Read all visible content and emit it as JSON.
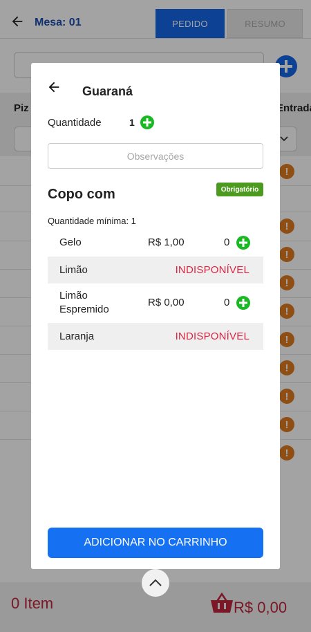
{
  "header": {
    "mesa": "Mesa: 01",
    "tab_pedido": "PEDIDO",
    "tab_resumo": "RESUMO"
  },
  "background": {
    "category_left": "Piz",
    "category_right": "Entrada"
  },
  "footer": {
    "items": "0 Item",
    "total": "R$ 0,00"
  },
  "modal": {
    "title": "Guaraná",
    "quantity_label": "Quantidade",
    "quantity_value": "1",
    "observations_placeholder": "Observações",
    "group": {
      "title": "Copo com",
      "required_badge": "Obrigatório",
      "min_quantity": "Quantidade mínima: 1",
      "options": [
        {
          "name": "Gelo",
          "price": "R$ 1,00",
          "count": "0"
        },
        {
          "name": "Limão",
          "status": "INDISPONÍVEL"
        },
        {
          "name": "Limão\nEspremido",
          "price": "R$ 0,00",
          "count": "0"
        },
        {
          "name": "Laranja",
          "status": "INDISPONÍVEL"
        }
      ]
    },
    "add_button": "ADICIONAR NO CARRINHO"
  },
  "colors": {
    "primary": "#1671f2",
    "add_green": "#1ab823",
    "required_badge": "#4c9a1f",
    "unavailable": "#e02442",
    "total_red": "#c0243c",
    "warning_orange": "#e07a1f"
  },
  "icons": {
    "back": "arrow-left-icon",
    "add": "plus-circle-icon",
    "warning": "exclamation-circle-icon",
    "basket": "basket-icon",
    "expand": "chevron-up-icon"
  }
}
